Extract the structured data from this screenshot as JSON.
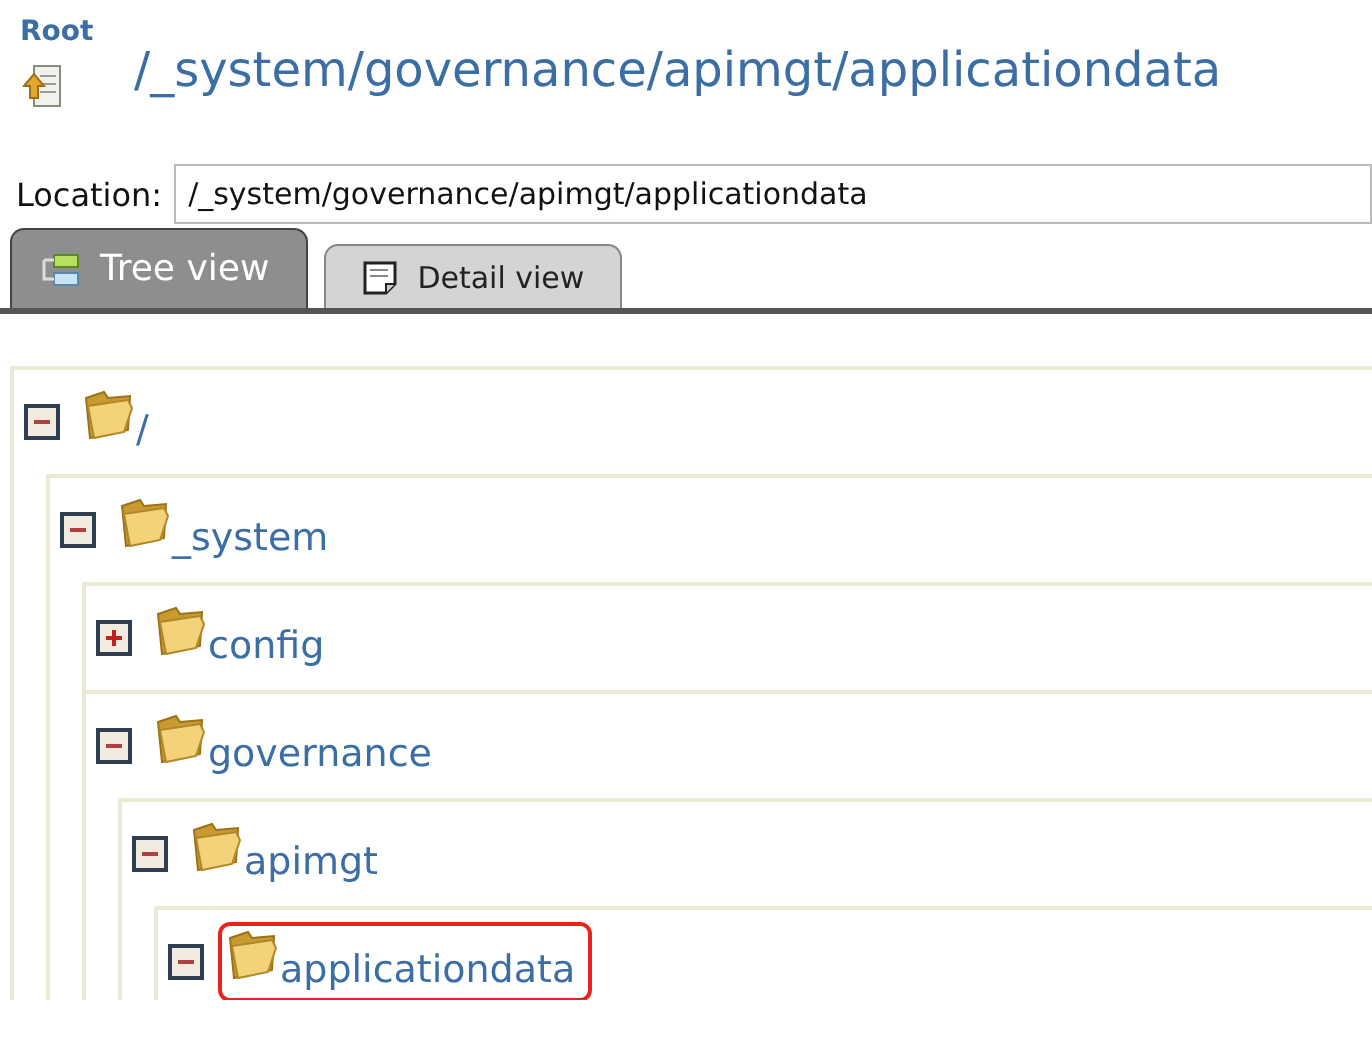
{
  "header": {
    "root_link": "Root",
    "path_title": "/_system/governance/apimgt/applicationdata"
  },
  "location": {
    "label": "Location:",
    "value": "/_system/governance/apimgt/applicationdata"
  },
  "tabs": [
    {
      "label": "Tree view",
      "kind": "tree",
      "selected": true
    },
    {
      "label": "Detail view",
      "kind": "detail",
      "selected": false
    }
  ],
  "tree": [
    {
      "label": "/",
      "expanded": true,
      "highlighted": false,
      "children": [
        {
          "label": "_system",
          "expanded": true,
          "highlighted": false,
          "children": [
            {
              "label": "config",
              "expanded": false,
              "highlighted": false
            },
            {
              "label": "governance",
              "expanded": true,
              "highlighted": false,
              "children": [
                {
                  "label": "apimgt",
                  "expanded": true,
                  "highlighted": false,
                  "children": [
                    {
                      "label": "applicationdata",
                      "expanded": true,
                      "highlighted": true
                    }
                  ]
                }
              ]
            }
          ]
        }
      ]
    }
  ]
}
